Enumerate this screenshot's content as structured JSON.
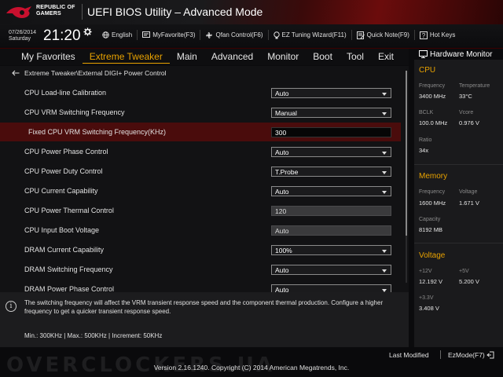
{
  "header": {
    "brand_line1": "REPUBLIC OF",
    "brand_line2": "GAMERS",
    "title": "UEFI BIOS Utility – Advanced Mode",
    "date": "07/26/2014",
    "day": "Saturday",
    "time": "21:20",
    "toolbar": [
      {
        "icon": "globe-icon",
        "label": "English"
      },
      {
        "icon": "favorite-icon",
        "label": "MyFavorite(F3)"
      },
      {
        "icon": "fan-icon",
        "label": "Qfan Control(F6)"
      },
      {
        "icon": "bulb-icon",
        "label": "EZ Tuning Wizard(F11)"
      },
      {
        "icon": "note-icon",
        "label": "Quick Note(F9)"
      },
      {
        "icon": "help-icon",
        "label": "Hot Keys"
      }
    ]
  },
  "nav": {
    "tabs": [
      "My Favorites",
      "Extreme Tweaker",
      "Main",
      "Advanced",
      "Monitor",
      "Boot",
      "Tool",
      "Exit"
    ],
    "active": "Extreme Tweaker"
  },
  "breadcrumb": "Extreme Tweaker\\External DIGI+ Power Control",
  "settings": [
    {
      "label": "CPU Load-line Calibration",
      "value": "Auto",
      "type": "dropdown"
    },
    {
      "label": "CPU VRM Switching Frequency",
      "value": "Manual",
      "type": "dropdown"
    },
    {
      "label": "Fixed CPU VRM Switching Frequency(KHz)",
      "value": "300",
      "type": "text",
      "selected": true
    },
    {
      "label": "CPU Power Phase Control",
      "value": "Auto",
      "type": "dropdown"
    },
    {
      "label": "CPU Power Duty Control",
      "value": "T.Probe",
      "type": "dropdown"
    },
    {
      "label": "CPU Current Capability",
      "value": "Auto",
      "type": "dropdown"
    },
    {
      "label": "CPU Power Thermal Control",
      "value": "120",
      "type": "readonly"
    },
    {
      "label": "CPU Input Boot Voltage",
      "value": "Auto",
      "type": "readonly"
    },
    {
      "label": "DRAM Current Capability",
      "value": "100%",
      "type": "dropdown"
    },
    {
      "label": "DRAM Switching Frequency",
      "value": "Auto",
      "type": "dropdown"
    },
    {
      "label": "DRAM Power Phase Control",
      "value": "Auto",
      "type": "dropdown"
    }
  ],
  "help": {
    "text": "The switching frequency will affect the VRM transient response speed and the component thermal production. Configure a higher frequency to get a quicker transient response speed.",
    "range": "Min.: 300KHz   |   Max.: 500KHz   |   Increment: 50KHz"
  },
  "hardware_monitor": {
    "title": "Hardware Monitor",
    "cpu": {
      "heading": "CPU",
      "frequency_label": "Frequency",
      "frequency": "3400 MHz",
      "temperature_label": "Temperature",
      "temperature": "33°C",
      "bclk_label": "BCLK",
      "bclk": "100.0 MHz",
      "vcore_label": "Vcore",
      "vcore": "0.976 V",
      "ratio_label": "Ratio",
      "ratio": "34x"
    },
    "memory": {
      "heading": "Memory",
      "frequency_label": "Frequency",
      "frequency": "1600 MHz",
      "voltage_label": "Voltage",
      "voltage": "1.671 V",
      "capacity_label": "Capacity",
      "capacity": "8192 MB"
    },
    "voltage": {
      "heading": "Voltage",
      "v12_label": "+12V",
      "v12": "12.192 V",
      "v5_label": "+5V",
      "v5": "5.200 V",
      "v33_label": "+3.3V",
      "v33": "3.408 V"
    }
  },
  "footer": {
    "last_modified": "Last Modified",
    "ezmode": "EzMode(F7)",
    "version": "Version 2.16.1240. Copyright (C) 2014 American Megatrends, Inc.",
    "watermark": "OVERCLOCKERS.UA"
  },
  "colors": {
    "accent": "#e8a200",
    "selected_row": "#4a0c0c",
    "background": "#121214"
  }
}
